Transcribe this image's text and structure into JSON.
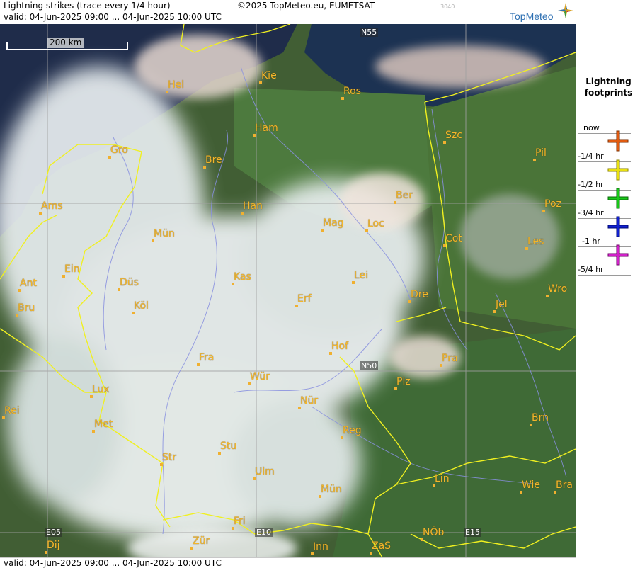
{
  "header": {
    "title": "Lightning strikes (trace every 1/4 hour)",
    "valid": "valid:  04-Jun-2025 09:00 ... 04-Jun-2025 10:00 UTC",
    "copyright": "©2025 TopMeteo.eu, EUMETSAT",
    "image_id": "3040",
    "logo_text": "TopMeteo"
  },
  "footer": {
    "valid": "valid:  04-Jun-2025 09:00 ... 04-Jun-2025 10:00 UTC"
  },
  "map": {
    "scale_label": "200 km",
    "grid_labels": [
      "N55",
      "N50",
      "E05",
      "E10",
      "E15"
    ],
    "cities": [
      "Hel",
      "Kie",
      "Ros",
      "Ham",
      "Gro",
      "Bre",
      "Szc",
      "Pil",
      "Ams",
      "Han",
      "Ber",
      "Poz",
      "Mag",
      "Loc",
      "Mün",
      "Cot",
      "Les",
      "Ein",
      "Kas",
      "Lei",
      "Ant",
      "Düs",
      "Wro",
      "Bru",
      "Köl",
      "Erf",
      "Dre",
      "Jel",
      "Hof",
      "Fra",
      "Pra",
      "Lux",
      "Wür",
      "Plz",
      "Rei",
      "Nür",
      "Met",
      "Reg",
      "Brn",
      "Stu",
      "Str",
      "Ulm",
      "Lin",
      "Wie",
      "Bra",
      "Mün",
      "Fri",
      "NÖb",
      "Dij",
      "Zür",
      "Inn",
      "ZaS"
    ],
    "colors": {
      "cities": "#f2b62c",
      "borders": "#f0f020",
      "rivers": "#8890e0",
      "grid": "#a0a0a0"
    }
  },
  "legend": {
    "title_line1": "Lightning",
    "title_line2": "footprints",
    "items": [
      {
        "label": "now",
        "color": "#e05a10",
        "icon": "plus-cross-icon"
      },
      {
        "label": "-1/4 hr",
        "color": "#e8e010",
        "icon": "plus-cross-icon"
      },
      {
        "label": "-1/2 hr",
        "color": "#18c818",
        "icon": "plus-cross-icon"
      },
      {
        "label": "-3/4 hr",
        "color": "#1020d0",
        "icon": "plus-cross-icon"
      },
      {
        "label": "-1 hr",
        "color": "#d020c8",
        "icon": "plus-cross-icon"
      },
      {
        "label": "-5/4 hr",
        "color": "",
        "icon": ""
      }
    ]
  }
}
